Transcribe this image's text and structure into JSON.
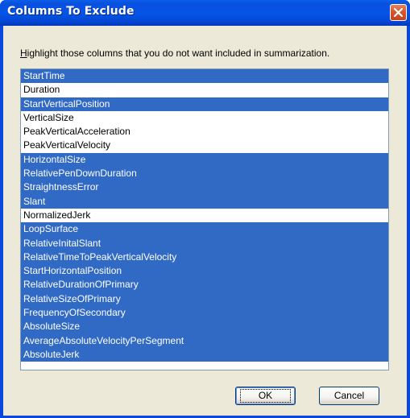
{
  "window": {
    "title": "Columns To Exclude"
  },
  "dialog": {
    "instruction_accel": "H",
    "instruction_rest": "ighlight those columns that you do not want included in summarization.",
    "items": [
      {
        "label": "StartTime",
        "selected": true
      },
      {
        "label": "Duration",
        "selected": false
      },
      {
        "label": "StartVerticalPosition",
        "selected": true
      },
      {
        "label": "VerticalSize",
        "selected": false
      },
      {
        "label": "PeakVerticalAcceleration",
        "selected": false
      },
      {
        "label": "PeakVerticalVelocity",
        "selected": false
      },
      {
        "label": "HorizontalSize",
        "selected": true
      },
      {
        "label": "RelativePenDownDuration",
        "selected": true
      },
      {
        "label": "StraightnessError",
        "selected": true
      },
      {
        "label": "Slant",
        "selected": true
      },
      {
        "label": "NormalizedJerk",
        "selected": false
      },
      {
        "label": "LoopSurface",
        "selected": true
      },
      {
        "label": "RelativeInitalSlant",
        "selected": true
      },
      {
        "label": "RelativeTimeToPeakVerticalVelocity",
        "selected": true
      },
      {
        "label": "StartHorizontalPosition",
        "selected": true
      },
      {
        "label": "RelativeDurationOfPrimary",
        "selected": true
      },
      {
        "label": "RelativeSizeOfPrimary",
        "selected": true
      },
      {
        "label": "FrequencyOfSecondary",
        "selected": true
      },
      {
        "label": "AbsoluteSize",
        "selected": true
      },
      {
        "label": "AverageAbsoluteVelocityPerSegment",
        "selected": true
      },
      {
        "label": "AbsoluteJerk",
        "selected": true
      }
    ],
    "ok_label": "OK",
    "cancel_label": "Cancel"
  },
  "icons": {
    "close": "close-icon"
  },
  "colors": {
    "selection": "#316ac5",
    "titlebar": "#0555e6",
    "dialog_bg": "#ece9d8"
  }
}
